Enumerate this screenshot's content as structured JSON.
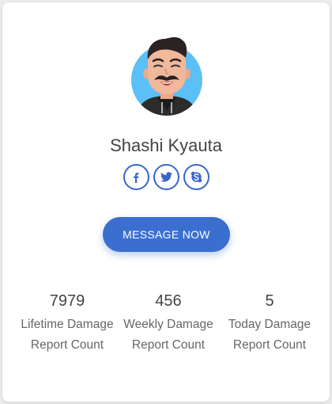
{
  "profile": {
    "name": "Shashi Kyauta",
    "avatar_icon": "cartoon-avatar-icon"
  },
  "socials": [
    {
      "icon": "facebook-icon"
    },
    {
      "icon": "twitter-icon"
    },
    {
      "icon": "skype-icon"
    }
  ],
  "actions": {
    "message_label": "MESSAGE NOW"
  },
  "stats": [
    {
      "value": "7979",
      "label": "Lifetime Damage Report Count"
    },
    {
      "value": "456",
      "label": "Weekly Damage Report Count"
    },
    {
      "value": "5",
      "label": "Today Damage Report Count"
    }
  ],
  "colors": {
    "accent": "#3a6fd0",
    "avatar_bg": "#5bc0f5",
    "card_bg": "#ffffff",
    "page_bg": "#ececec"
  }
}
